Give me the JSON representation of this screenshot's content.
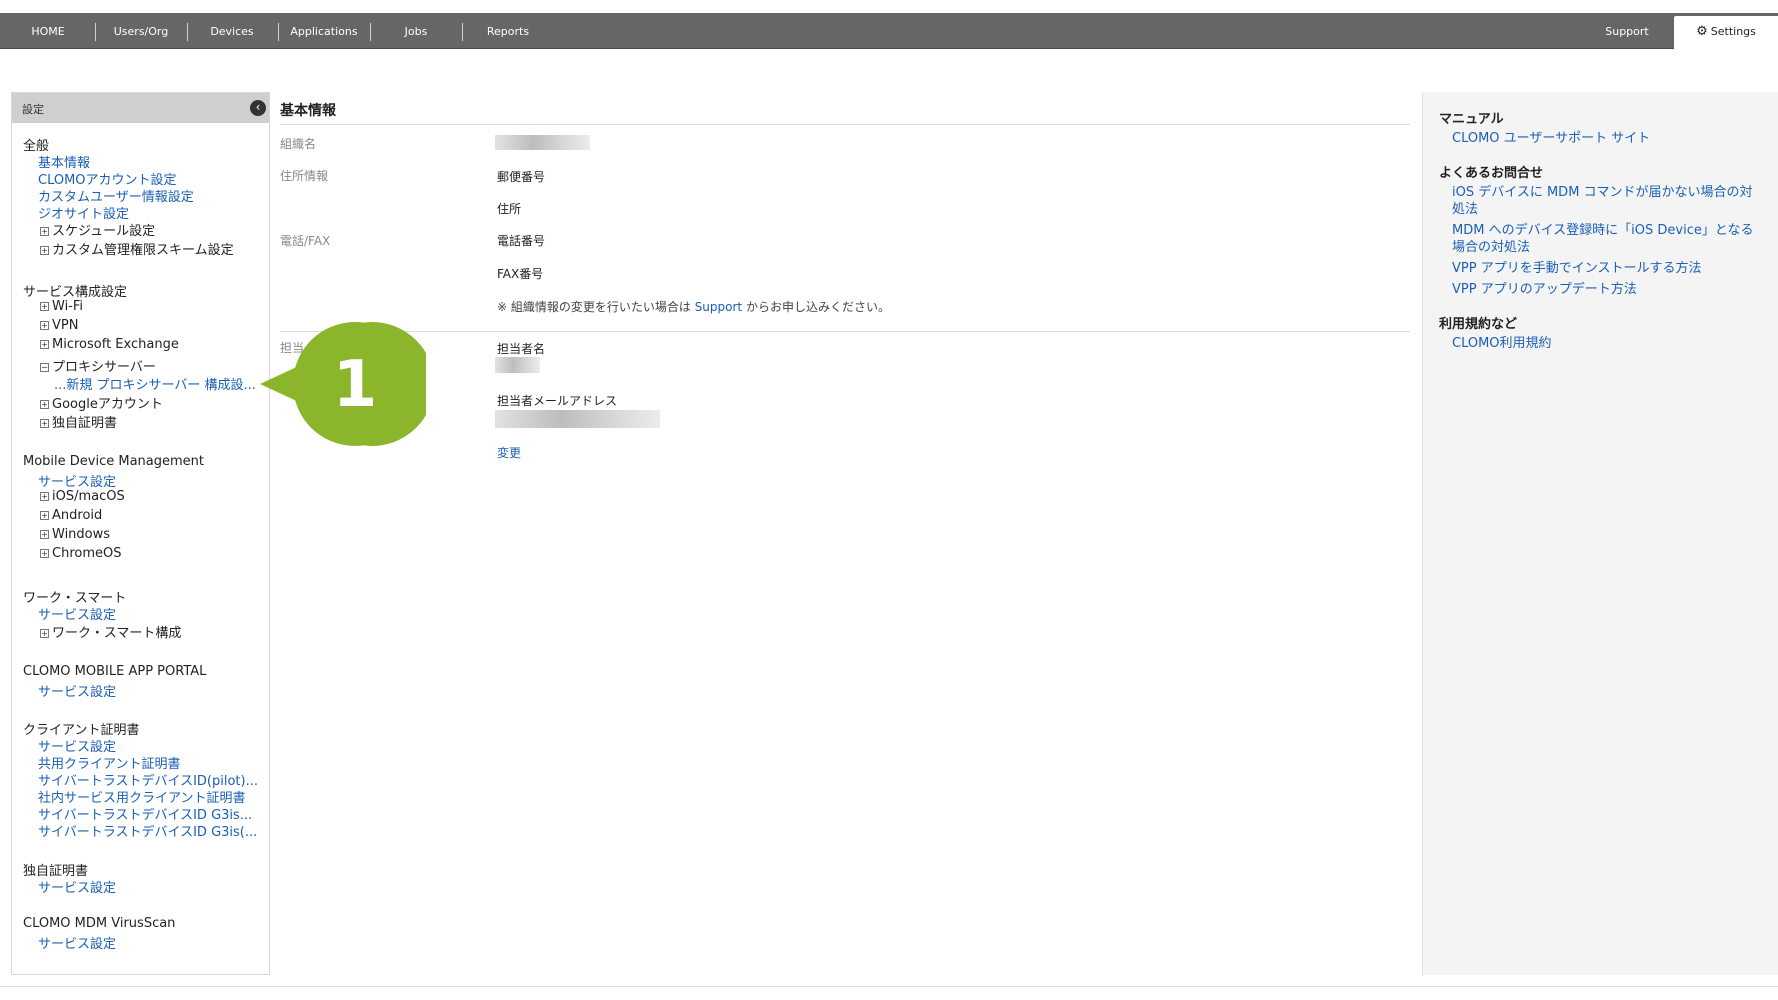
{
  "topnav": {
    "items": [
      "HOME",
      "Users/Org",
      "Devices",
      "Applications",
      "Jobs",
      "Reports"
    ],
    "support": "Support",
    "settings": "Settings"
  },
  "sidebar": {
    "title": "設定",
    "general": {
      "heading": "全般",
      "links": [
        "基本情報",
        "CLOMOアカウント設定",
        "カスタムユーザー情報設定",
        "ジオサイト設定"
      ],
      "trees": [
        "スケジュール設定",
        "カスタム管理権限スキーム設定"
      ]
    },
    "service": {
      "heading": "サービス構成設定",
      "trees": [
        "Wi-Fi",
        "VPN",
        "Microsoft Exchange",
        "プロキシサーバー"
      ],
      "proxy_sub": "...新規 プロキシサーバー 構成設...",
      "trees2": [
        "Googleアカウント",
        "独自証明書"
      ]
    },
    "mdm": {
      "heading": "Mobile Device Management",
      "link": "サービス設定",
      "trees": [
        "iOS/macOS",
        "Android",
        "Windows",
        "ChromeOS"
      ]
    },
    "work": {
      "heading": "ワーク・スマート",
      "link": "サービス設定",
      "tree": "ワーク・スマート構成"
    },
    "portal": {
      "heading": "CLOMO MOBILE APP PORTAL",
      "link": "サービス設定"
    },
    "client_cert": {
      "heading": "クライアント証明書",
      "links": [
        "サービス設定",
        "共用クライアント証明書",
        "サイバートラストデバイスID(pilot)...",
        "社内サービス用クライアント証明書",
        "サイバートラストデバイスID G3is...",
        "サイバートラストデバイスID G3is(..."
      ]
    },
    "own_cert": {
      "heading": "独自証明書",
      "link": "サービス設定"
    },
    "virusscan": {
      "heading": "CLOMO MDM VirusScan",
      "link": "サービス設定"
    }
  },
  "main": {
    "title": "基本情報",
    "org_name_label": "組織名",
    "address_label": "住所情報",
    "postal_label": "郵便番号",
    "address_field": "住所",
    "phone_label": "電話/FAX",
    "phone_field": "電話番号",
    "fax_field": "FAX番号",
    "note_before": "※ 組織情報の変更を行いたい場合は ",
    "note_link": "Support",
    "note_after": " からお申し込みください。",
    "contact_label": "担当",
    "contact_name_label": "担当者名",
    "contact_email_label": "担当者メールアドレス",
    "change_link": "変更"
  },
  "callout": {
    "number": "1",
    "color": "#8bb52a"
  },
  "rightpanel": {
    "manual_heading": "マニュアル",
    "manual_link": "CLOMO ユーザーサポート サイト",
    "faq_heading": "よくあるお問合せ",
    "faq_links": [
      "iOS デバイスに MDM コマンドが届かない場合の対処法",
      "MDM へのデバイス登録時に「iOS Device」となる場合の対処法",
      "VPP アプリを手動でインストールする方法",
      "VPP アプリのアップデート方法"
    ],
    "terms_heading": "利用規約など",
    "terms_link": "CLOMO利用規約"
  }
}
